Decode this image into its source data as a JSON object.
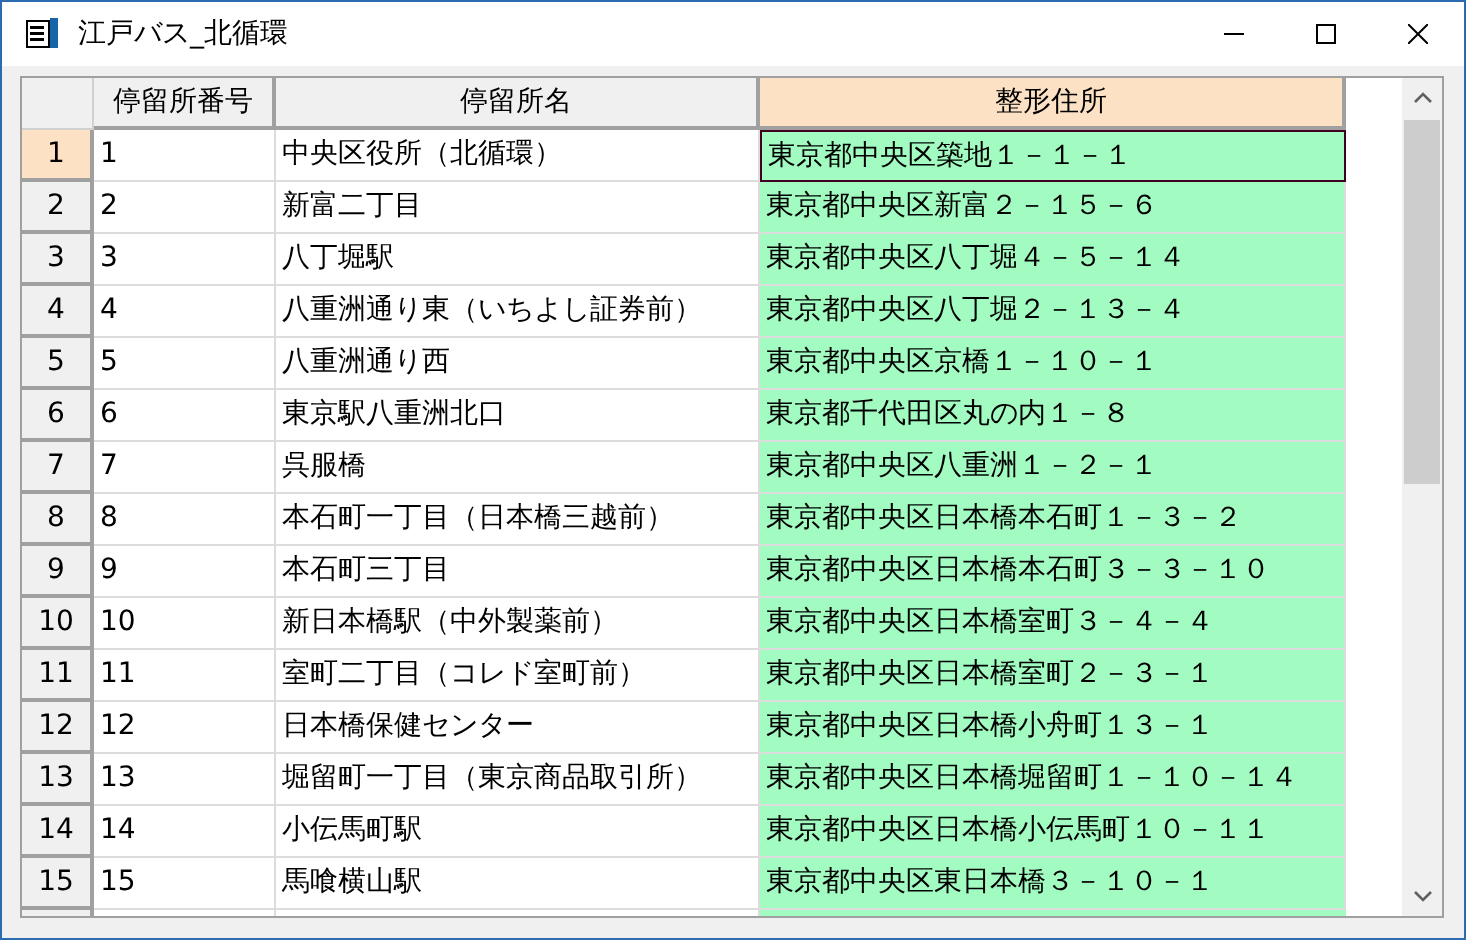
{
  "window": {
    "title": "江戸バス_北循環"
  },
  "table": {
    "columns": [
      {
        "label": "停留所番号",
        "selected": false
      },
      {
        "label": "停留所名",
        "selected": false
      },
      {
        "label": "整形住所",
        "selected": true
      }
    ],
    "rows": [
      {
        "header": "1",
        "selected": true,
        "cells": [
          "1",
          "中央区役所（北循環）",
          "東京都中央区築地１－１－１"
        ]
      },
      {
        "header": "2",
        "selected": false,
        "cells": [
          "2",
          "新富二丁目",
          "東京都中央区新富２－１５－６"
        ]
      },
      {
        "header": "3",
        "selected": false,
        "cells": [
          "3",
          "八丁堀駅",
          "東京都中央区八丁堀４－５－１４"
        ]
      },
      {
        "header": "4",
        "selected": false,
        "cells": [
          "4",
          "八重洲通り東（いちよし証券前）",
          "東京都中央区八丁堀２－１３－４"
        ]
      },
      {
        "header": "5",
        "selected": false,
        "cells": [
          "5",
          "八重洲通り西",
          "東京都中央区京橋１－１０－１"
        ]
      },
      {
        "header": "6",
        "selected": false,
        "cells": [
          "6",
          "東京駅八重洲北口",
          "東京都千代田区丸の内１－８"
        ]
      },
      {
        "header": "7",
        "selected": false,
        "cells": [
          "7",
          "呉服橋",
          "東京都中央区八重洲１－２－１"
        ]
      },
      {
        "header": "8",
        "selected": false,
        "cells": [
          "8",
          "本石町一丁目（日本橋三越前）",
          "東京都中央区日本橋本石町１－３－２"
        ]
      },
      {
        "header": "9",
        "selected": false,
        "cells": [
          "9",
          "本石町三丁目",
          "東京都中央区日本橋本石町３－３－１０"
        ]
      },
      {
        "header": "10",
        "selected": false,
        "cells": [
          "10",
          "新日本橋駅（中外製薬前）",
          "東京都中央区日本橋室町３－４－４"
        ]
      },
      {
        "header": "11",
        "selected": false,
        "cells": [
          "11",
          "室町二丁目（コレド室町前）",
          "東京都中央区日本橋室町２－３－１"
        ]
      },
      {
        "header": "12",
        "selected": false,
        "cells": [
          "12",
          "日本橋保健センター",
          "東京都中央区日本橋小舟町１３－１"
        ]
      },
      {
        "header": "13",
        "selected": false,
        "cells": [
          "13",
          "堀留町一丁目（東京商品取引所）",
          "東京都中央区日本橋堀留町１－１０－１４"
        ]
      },
      {
        "header": "14",
        "selected": false,
        "cells": [
          "14",
          "小伝馬町駅",
          "東京都中央区日本橋小伝馬町１０－１１"
        ]
      },
      {
        "header": "15",
        "selected": false,
        "cells": [
          "15",
          "馬喰横山駅",
          "東京都中央区東日本橋３－１０－１"
        ]
      }
    ]
  }
}
